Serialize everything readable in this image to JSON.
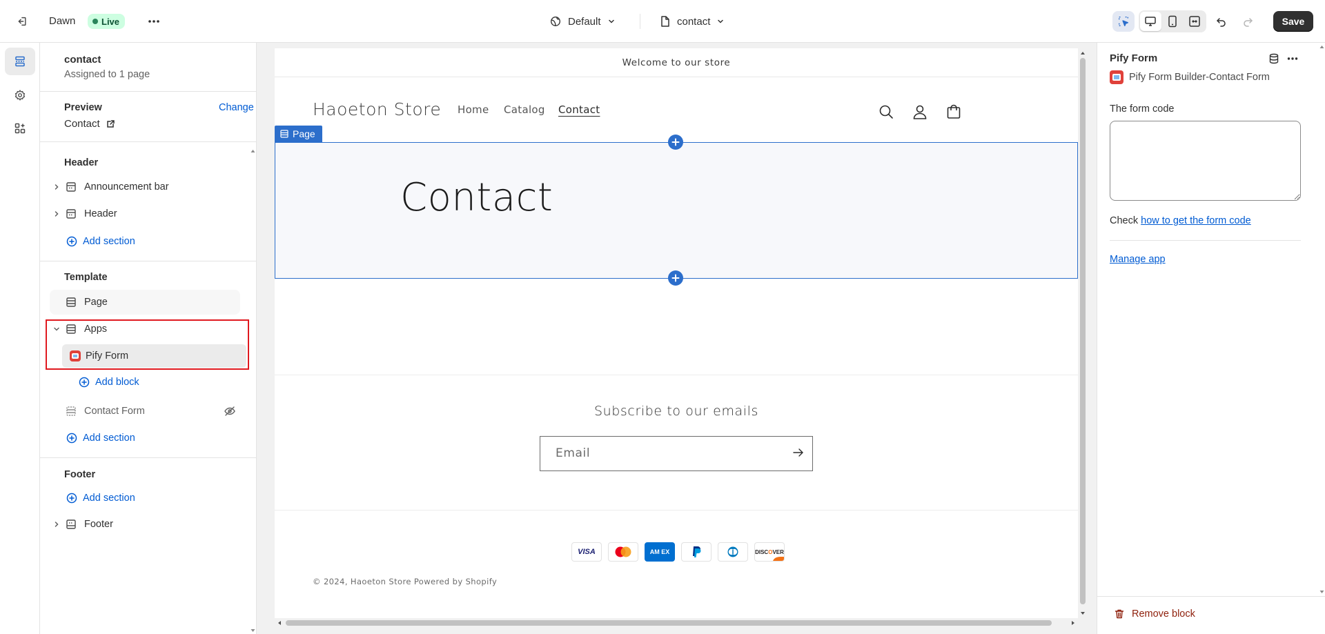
{
  "topbar": {
    "theme_name": "Dawn",
    "live_label": "Live",
    "template_dropdown": "Default",
    "page_dropdown": "contact",
    "save_label": "Save"
  },
  "sidebar": {
    "title": "contact",
    "subtitle": "Assigned to 1 page",
    "preview_label": "Preview",
    "change_label": "Change",
    "preview_page": "Contact",
    "header_group": "Header",
    "header_items": [
      "Announcement bar",
      "Header"
    ],
    "add_section": "Add section",
    "template_group": "Template",
    "template_items": {
      "page": "Page",
      "apps": "Apps",
      "pify_form": "Pify Form",
      "add_block": "Add block",
      "contact_form": "Contact Form"
    },
    "footer_group": "Footer",
    "footer_items": [
      "Footer"
    ]
  },
  "preview": {
    "announcement": "Welcome to our store",
    "store_name": "Haoeton Store",
    "nav": [
      "Home",
      "Catalog",
      "Contact"
    ],
    "page_tag": "Page",
    "page_title": "Contact",
    "subscribe_title": "Subscribe to our emails",
    "email_placeholder": "Email",
    "payment_methods": [
      "Visa",
      "Mastercard",
      "American Express",
      "PayPal",
      "Diners Club",
      "Discover"
    ],
    "copyright": "© 2024, Haoeton Store Powered by Shopify"
  },
  "settings": {
    "title": "Pify Form",
    "app_name": "Pify Form Builder-Contact Form",
    "form_code_label": "The form code",
    "form_code_value": "",
    "check_prefix": "Check ",
    "check_link": "how to get the form code",
    "manage_app": "Manage app",
    "remove_block": "Remove block"
  },
  "colors": {
    "accent": "#2c6ecb",
    "link": "#005bd3",
    "highlight_outline": "#e0191f",
    "live_badge": "#cdfee1",
    "danger": "#8e1f0b"
  }
}
